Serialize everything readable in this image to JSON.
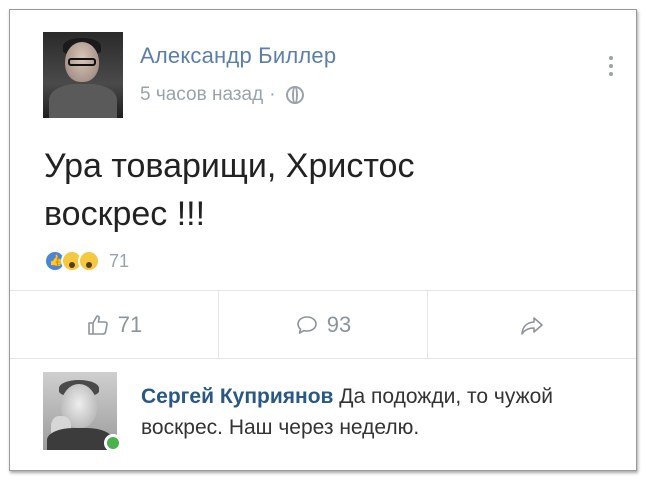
{
  "post": {
    "author": "Александр Биллер",
    "time": "5 часов назад",
    "separator": "·",
    "text_line1": "Ура товарищи, Христос",
    "text_line2": "воскрес !!!",
    "reaction_count": "71"
  },
  "actions": {
    "like_count": "71",
    "comment_count": "93"
  },
  "comment": {
    "author": "Сергей Куприянов",
    "text": "Да подожди, то чужой воскрес. Наш через неделю."
  },
  "colors": {
    "author_link": "#5b7fa8",
    "comment_author": "#2a5885",
    "secondary_text": "#9aa3ab",
    "online": "#4bb34b"
  },
  "icons": [
    "globe-icon",
    "more-icon",
    "like-icon",
    "comment-icon",
    "share-icon"
  ]
}
